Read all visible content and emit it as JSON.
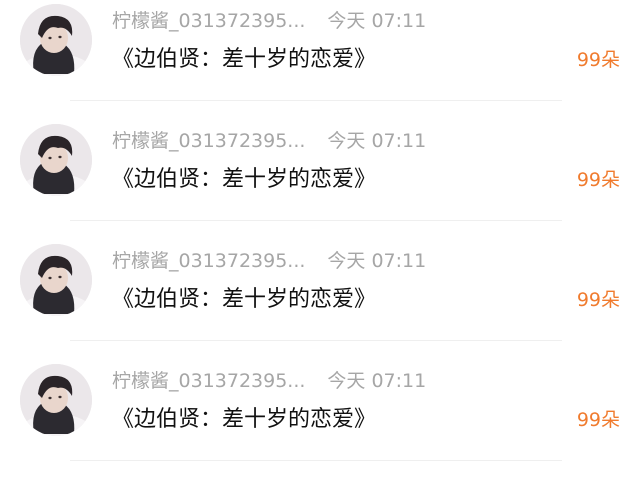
{
  "items": [
    {
      "name": "柠檬酱_031372395...",
      "time": "今天 07:11",
      "title": "《边伯贤：差十岁的恋爱》",
      "count": "99朵",
      "avatar_icon": "user-avatar"
    },
    {
      "name": "柠檬酱_031372395...",
      "time": "今天 07:11",
      "title": "《边伯贤：差十岁的恋爱》",
      "count": "99朵",
      "avatar_icon": "user-avatar"
    },
    {
      "name": "柠檬酱_031372395...",
      "time": "今天 07:11",
      "title": "《边伯贤：差十岁的恋爱》",
      "count": "99朵",
      "avatar_icon": "user-avatar"
    },
    {
      "name": "柠檬酱_031372395...",
      "time": "今天 07:11",
      "title": "《边伯贤：差十岁的恋爱》",
      "count": "99朵",
      "avatar_icon": "user-avatar"
    }
  ],
  "colors": {
    "count": "#f07b2e",
    "meta": "#a6a6a6",
    "title": "#111111"
  }
}
